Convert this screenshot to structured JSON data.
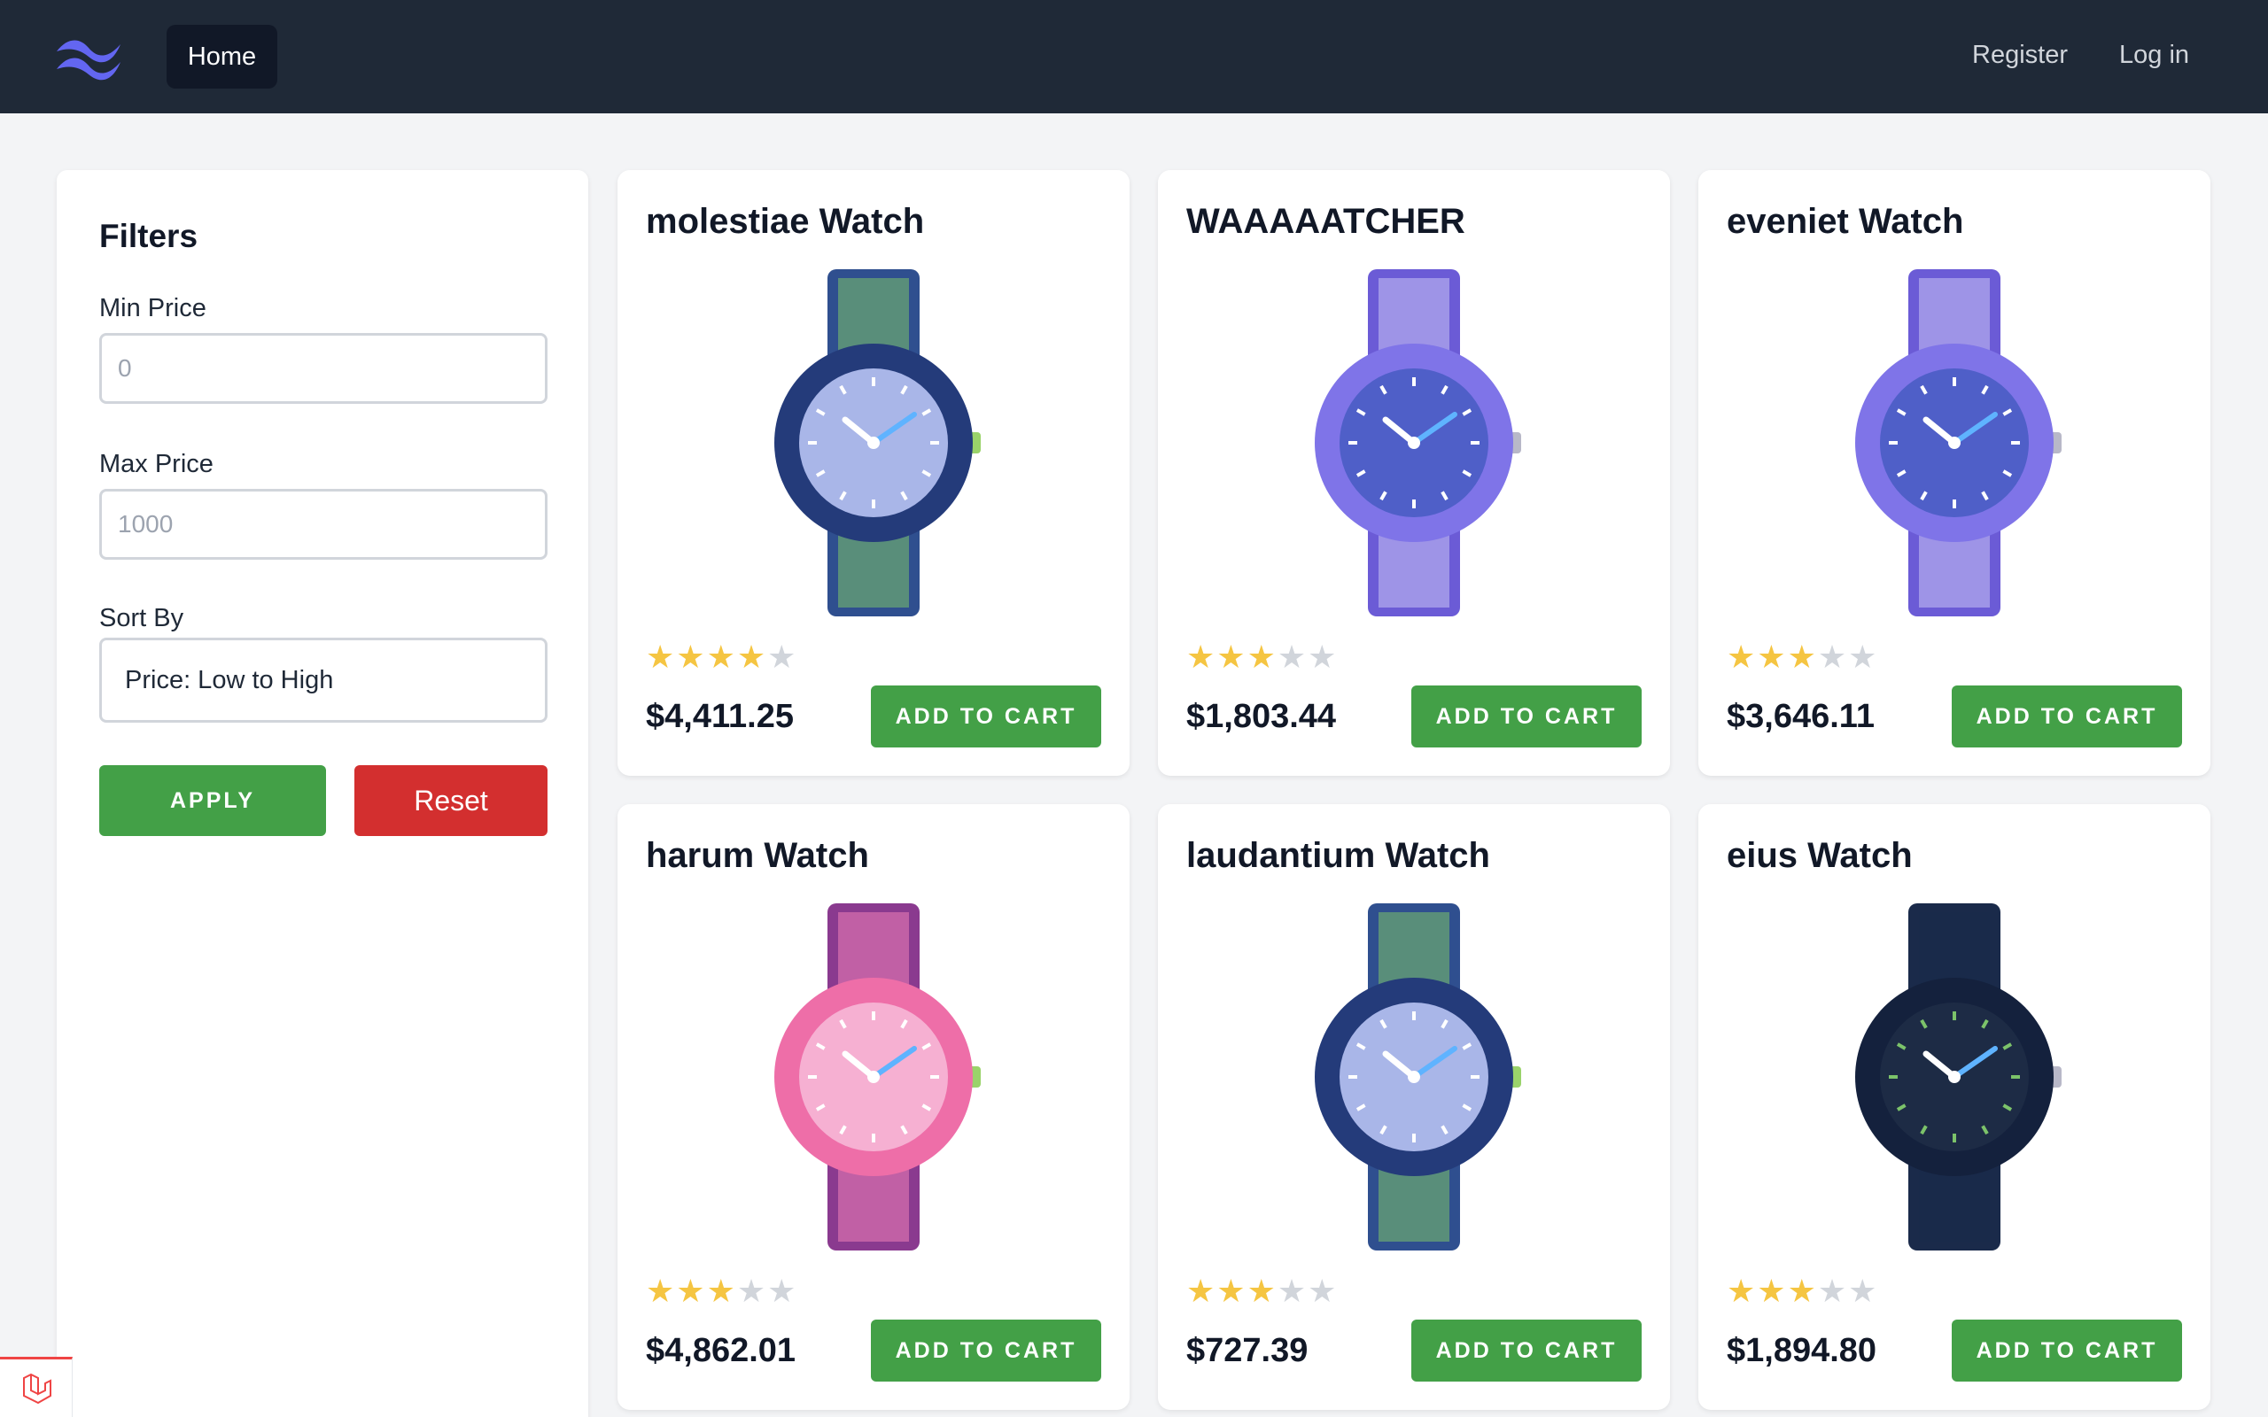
{
  "nav": {
    "home_label": "Home",
    "register_label": "Register",
    "login_label": "Log in"
  },
  "filters": {
    "title": "Filters",
    "min_price_label": "Min Price",
    "min_price_placeholder": "0",
    "max_price_label": "Max Price",
    "max_price_placeholder": "1000",
    "sort_label": "Sort By",
    "sort_value": "Price: Low to High",
    "apply_label": "APPLY",
    "reset_label": "Reset"
  },
  "colors": {
    "nav_bg": "#1f2937",
    "accent_green": "#43a047",
    "reset_red": "#d32f2f",
    "star_filled": "#f5c542",
    "star_empty": "#d1d5db"
  },
  "products": [
    {
      "name": "molestiae Watch",
      "price": "$4,411.25",
      "rating": 4,
      "cart_label": "ADD TO CART",
      "style": "navy-green"
    },
    {
      "name": "WAAAAATCHER",
      "price": "$1,803.44",
      "rating": 3,
      "cart_label": "ADD TO CART",
      "style": "purple-space"
    },
    {
      "name": "eveniet Watch",
      "price": "$3,646.11",
      "rating": 3,
      "cart_label": "ADD TO CART",
      "style": "purple-space"
    },
    {
      "name": "harum Watch",
      "price": "$4,862.01",
      "rating": 3,
      "cart_label": "ADD TO CART",
      "style": "pink"
    },
    {
      "name": "laudantium Watch",
      "price": "$727.39",
      "rating": 3,
      "cart_label": "ADD TO CART",
      "style": "navy-green"
    },
    {
      "name": "eius Watch",
      "price": "$1,894.80",
      "rating": 3,
      "cart_label": "ADD TO CART",
      "style": "dark-navy"
    }
  ]
}
